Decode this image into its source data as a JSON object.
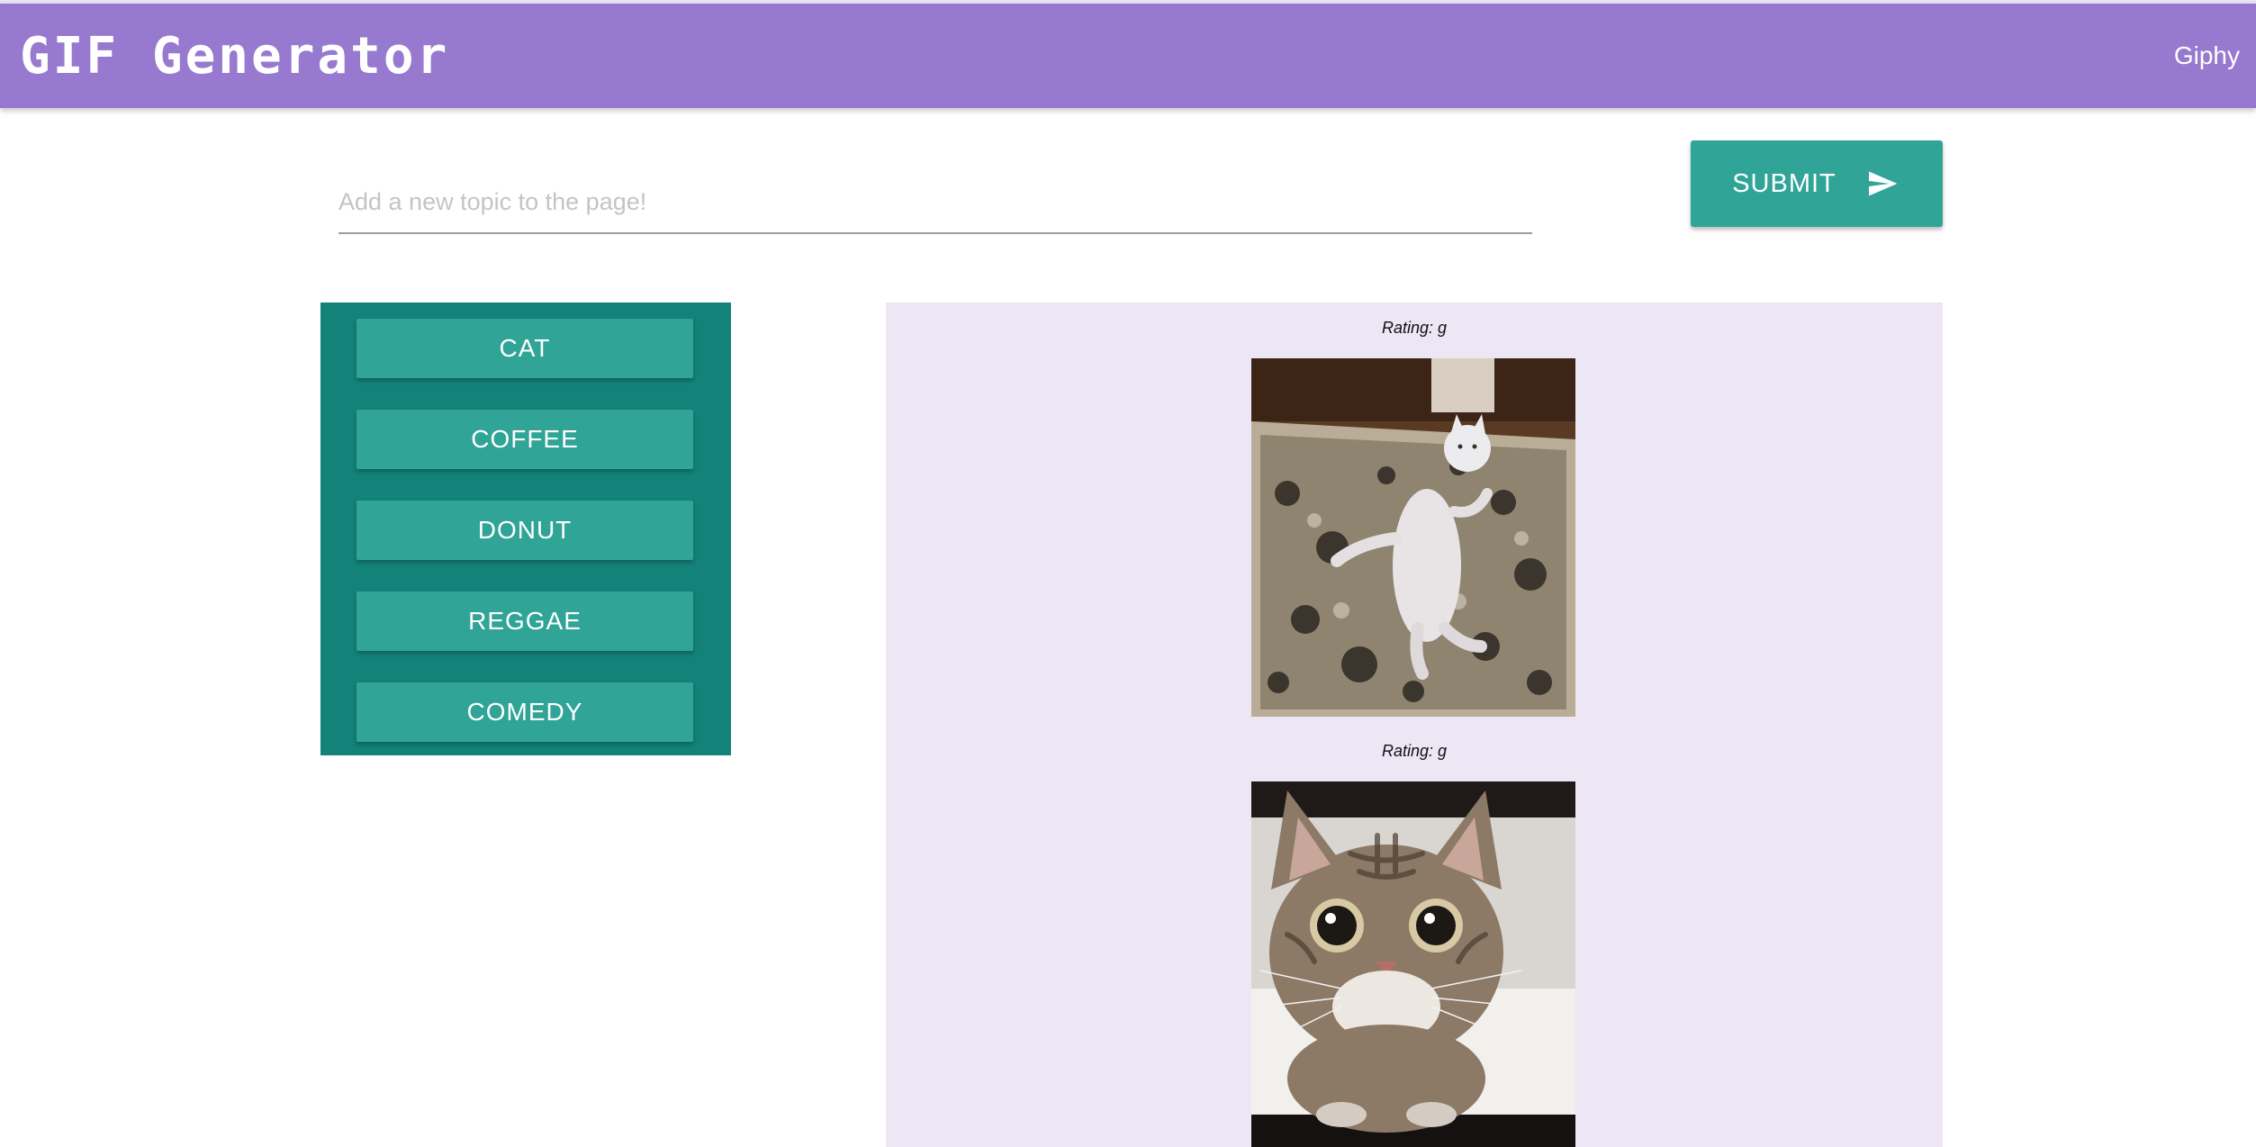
{
  "navbar": {
    "brand": "GIF Generator",
    "link": "Giphy",
    "color": "#9779cf"
  },
  "search": {
    "placeholder": "Add a new topic to the page!",
    "value": ""
  },
  "submit": {
    "label": "SUBMIT",
    "icon": "send-icon",
    "color": "#2fa497"
  },
  "topics": {
    "panel_color": "#138279",
    "buttons": [
      "CAT",
      "COFFEE",
      "DONUT",
      "REGGAE",
      "COMEDY"
    ]
  },
  "gifs": [
    {
      "rating": "Rating: g",
      "subject": "standing white cat on patterned rug"
    },
    {
      "rating": "Rating: g",
      "subject": "tabby cat looking up"
    }
  ],
  "gif_panel_color": "#ece6f5"
}
